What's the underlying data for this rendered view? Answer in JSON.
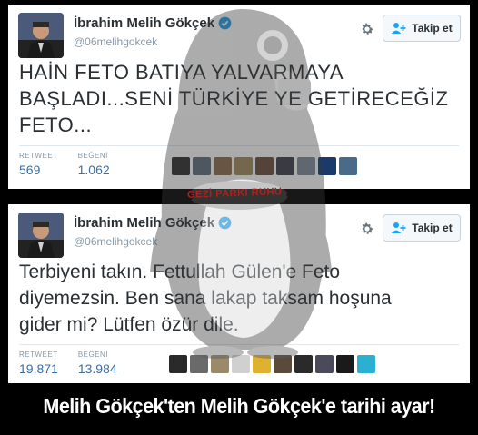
{
  "tweets": [
    {
      "author_name": "İbrahim Melih Gökçek",
      "handle": "@06melihgokcek",
      "follow_label": "Takip et",
      "text": "HAİN FETO BATIYA YALVARMAYA\nBAŞLADI...SENİ TÜRKİYE YE GETİRECEĞİZ\nFETO...",
      "retweet_label": "RETWEET",
      "retweet_count": "569",
      "like_label": "BEĞENİ",
      "like_count": "1.062"
    },
    {
      "author_name": "İbrahim Melih Gökçek",
      "handle": "@06melihgokcek",
      "follow_label": "Takip et",
      "text": "Terbiyeni takın. Fettullah Gülen'e Feto\ndiyemezsin. Ben sana lakap taksam hoşuna\ngider mi? Lütfen özür dile.",
      "retweet_label": "RETWEET",
      "retweet_count": "19.871",
      "like_label": "BEĞENİ",
      "like_count": "13.984"
    }
  ],
  "stamp_text": "GEZİ PARKI RUHU",
  "caption": "Melih Gökçek'ten Melih Gökçek'e tarihi ayar!",
  "colors": {
    "verified": "#1da1f2",
    "stat_value": "#3b6f9e",
    "stamp": "#b3201b",
    "background": "#000000"
  },
  "icons": [
    "verified-badge-icon",
    "gear-icon",
    "follow-user-icon",
    "penguin-gasmask-watermark"
  ]
}
